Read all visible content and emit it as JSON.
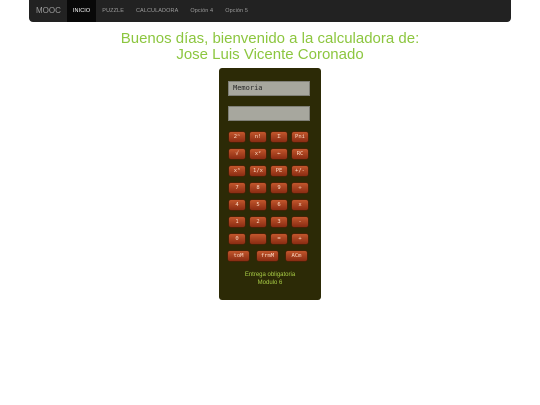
{
  "nav": {
    "brand": "MOOC",
    "items": [
      {
        "label": "INICIO",
        "active": true
      },
      {
        "label": "PUZZLE",
        "active": false
      },
      {
        "label": "CALCULADORA",
        "active": false
      },
      {
        "label": "Opción 4",
        "active": false
      },
      {
        "label": "Opción 5",
        "active": false
      }
    ]
  },
  "greeting": {
    "line1": "Buenos días, bienvenido a la calculadora de:",
    "line2": "Jose Luis Vicente Coronado"
  },
  "calculator": {
    "memory_placeholder": "Memoria",
    "display_value": "",
    "rows": [
      [
        "2ⁿ",
        "n!",
        "Σ",
        "Pni"
      ],
      [
        "√",
        "x²",
        "←",
        "RC"
      ],
      [
        "x³",
        "1/x",
        "PE",
        "+/-"
      ],
      [
        "7",
        "8",
        "9",
        "÷"
      ],
      [
        "4",
        "5",
        "6",
        "x"
      ],
      [
        "1",
        "2",
        "3",
        "-"
      ],
      [
        "0",
        "",
        "=",
        "+"
      ]
    ],
    "memory_buttons": [
      "toM",
      "frmM",
      "ACm"
    ],
    "footer_line1": "Entrega obligatoria",
    "footer_line2": "Modulo 6"
  },
  "colors": {
    "accent_green": "#8cc63f",
    "navbar_bg": "#222222",
    "calculator_bg": "#2c2a06",
    "button_orange": "#a8401d"
  }
}
